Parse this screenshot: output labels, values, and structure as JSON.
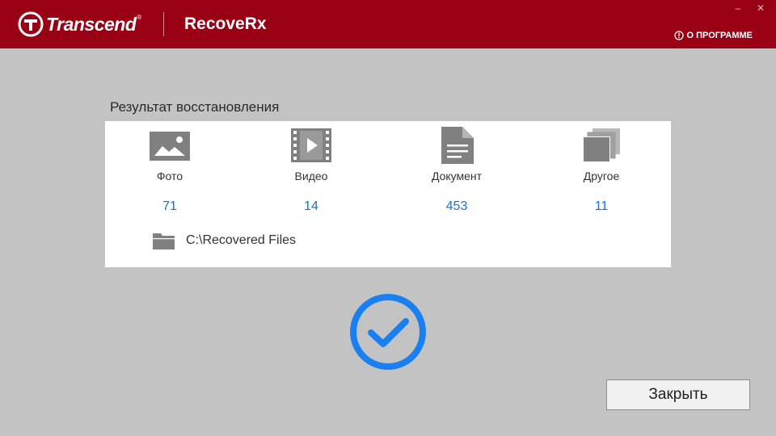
{
  "header": {
    "brand": "Transcend",
    "brand_mark": "®",
    "app_title": "RecoveRx",
    "about_label": "О ПРОГРАММЕ",
    "minimize_label": "–",
    "close_label": "✕"
  },
  "result": {
    "title": "Результат восстановления",
    "categories": [
      {
        "label": "Фото",
        "count": "71",
        "icon": "photo-icon"
      },
      {
        "label": "Видео",
        "count": "14",
        "icon": "video-icon"
      },
      {
        "label": "Документ",
        "count": "453",
        "icon": "document-icon"
      },
      {
        "label": "Другое",
        "count": "11",
        "icon": "other-files-icon"
      }
    ],
    "output_path": "C:\\Recovered Files"
  },
  "footer": {
    "close_button_label": "Закрыть"
  },
  "colors": {
    "header_bg": "#9a0014",
    "accent_blue": "#1a73c9",
    "check_blue": "#1a7ff0",
    "background": "#c3c3c3"
  }
}
